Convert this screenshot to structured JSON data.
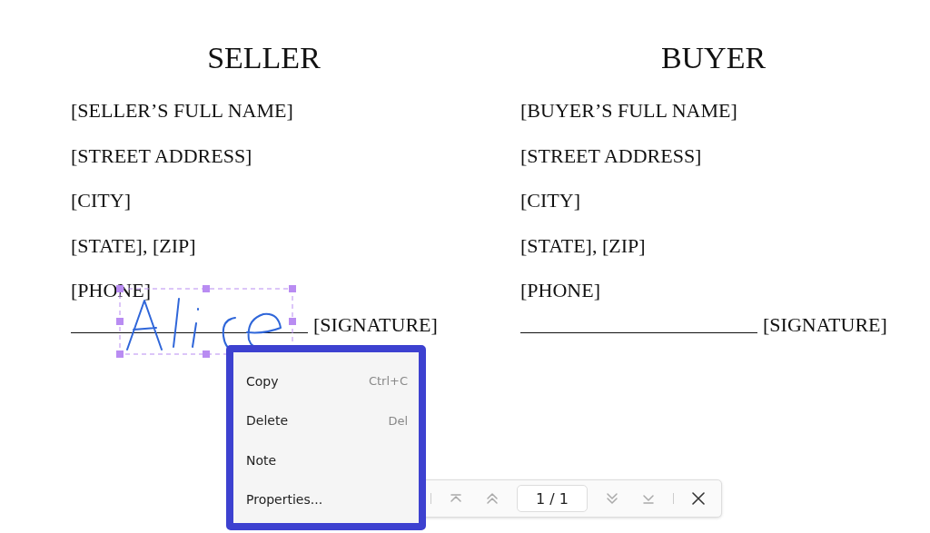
{
  "document": {
    "columns": [
      {
        "heading": "SELLER",
        "lines": [
          "[SELLER’S FULL NAME]",
          "[STREET ADDRESS]",
          "[CITY]",
          "[STATE], [ZIP]",
          "[PHONE]"
        ],
        "signature_label": "[SIGNATURE]"
      },
      {
        "heading": "BUYER",
        "lines": [
          "[BUYER’S FULL NAME]",
          "[STREET ADDRESS]",
          "[CITY]",
          "[STATE], [ZIP]",
          "[PHONE]"
        ],
        "signature_label": "[SIGNATURE]"
      }
    ]
  },
  "signature": {
    "selected": true
  },
  "context_menu": {
    "items": [
      {
        "label": "Copy",
        "shortcut": "Ctrl+C"
      },
      {
        "label": "Delete",
        "shortcut": "Del"
      },
      {
        "label": "Note"
      },
      {
        "label": "Properties..."
      }
    ]
  },
  "page_toolbar": {
    "page_field": "1 / 1"
  }
}
